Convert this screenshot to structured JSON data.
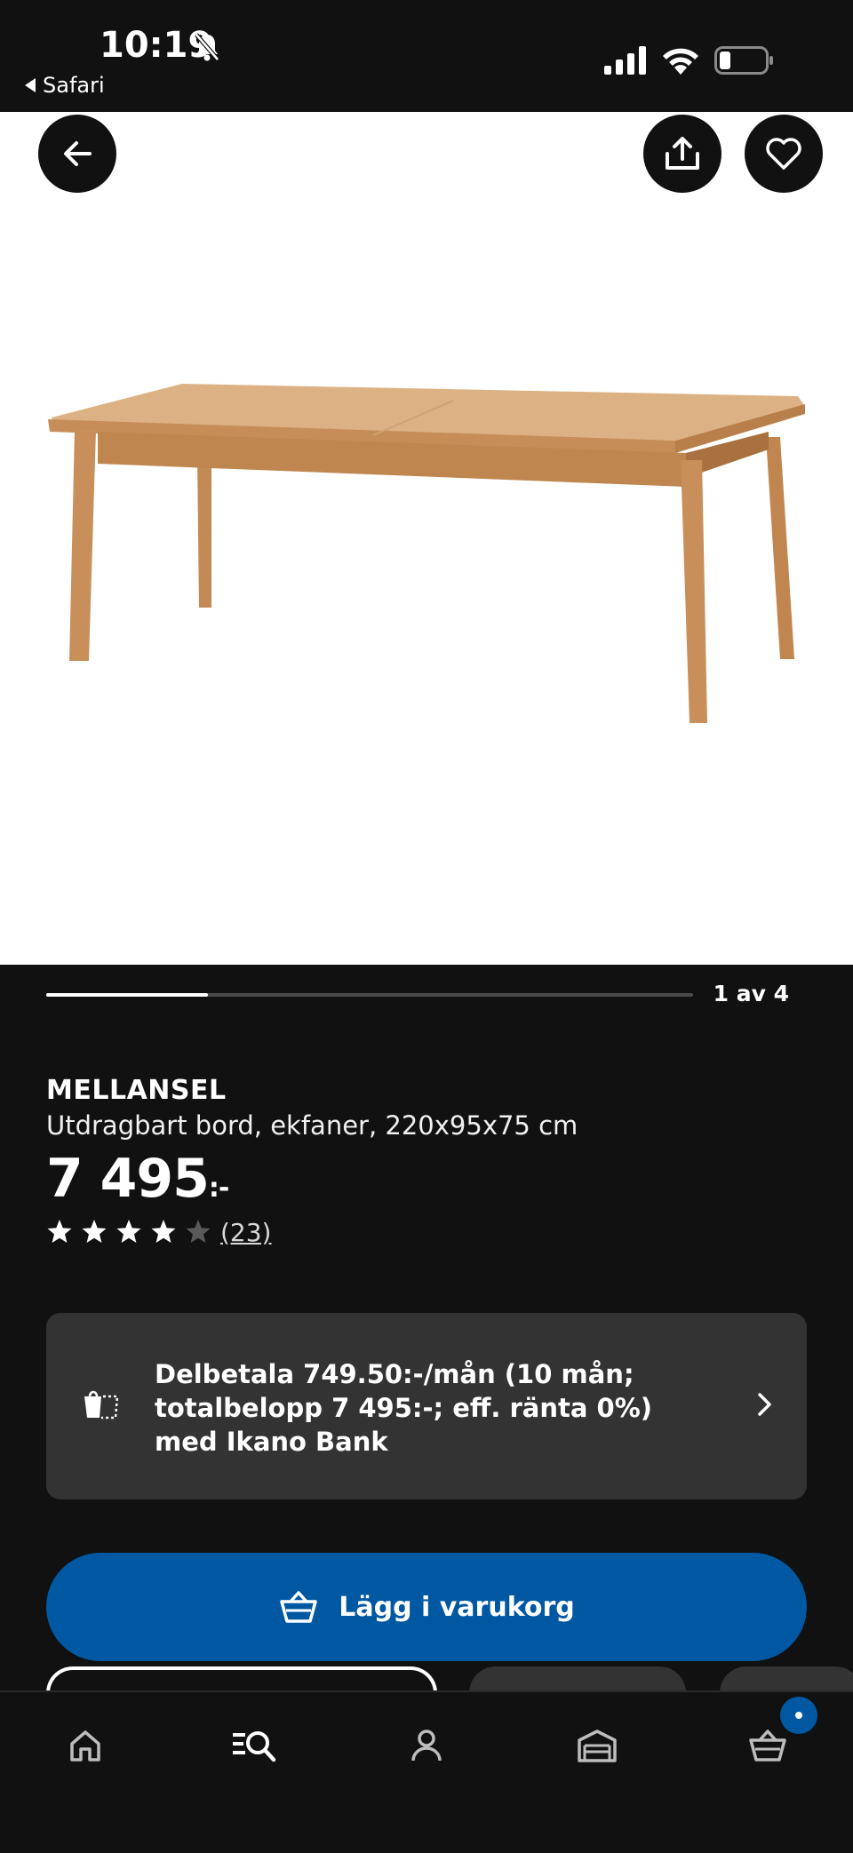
{
  "status_bar": {
    "time": "10:19",
    "back_app": "Safari"
  },
  "gallery": {
    "counter": "1 av 4",
    "progress": 0.25
  },
  "product": {
    "name": "MELLANSEL",
    "description": "Utdragbart bord, ekfaner, 220x95x75 cm",
    "price": "7 495",
    "price_suffix": ":-",
    "rating": 4,
    "rating_max": 5,
    "reviews": "(23)"
  },
  "finance": {
    "text": "Delbetala 749.50:-/mån (10 mån; totalbelopp 7 495:-; eff. ränta 0%) med Ikano Bank"
  },
  "actions": {
    "add_to_cart": "Lägg i varukorg"
  },
  "nav": {
    "items": [
      "home-icon",
      "search-icon",
      "profile-icon",
      "store-icon",
      "cart-icon"
    ]
  },
  "colors": {
    "background": "#111111",
    "accent": "#0058a3",
    "card": "#333333"
  }
}
